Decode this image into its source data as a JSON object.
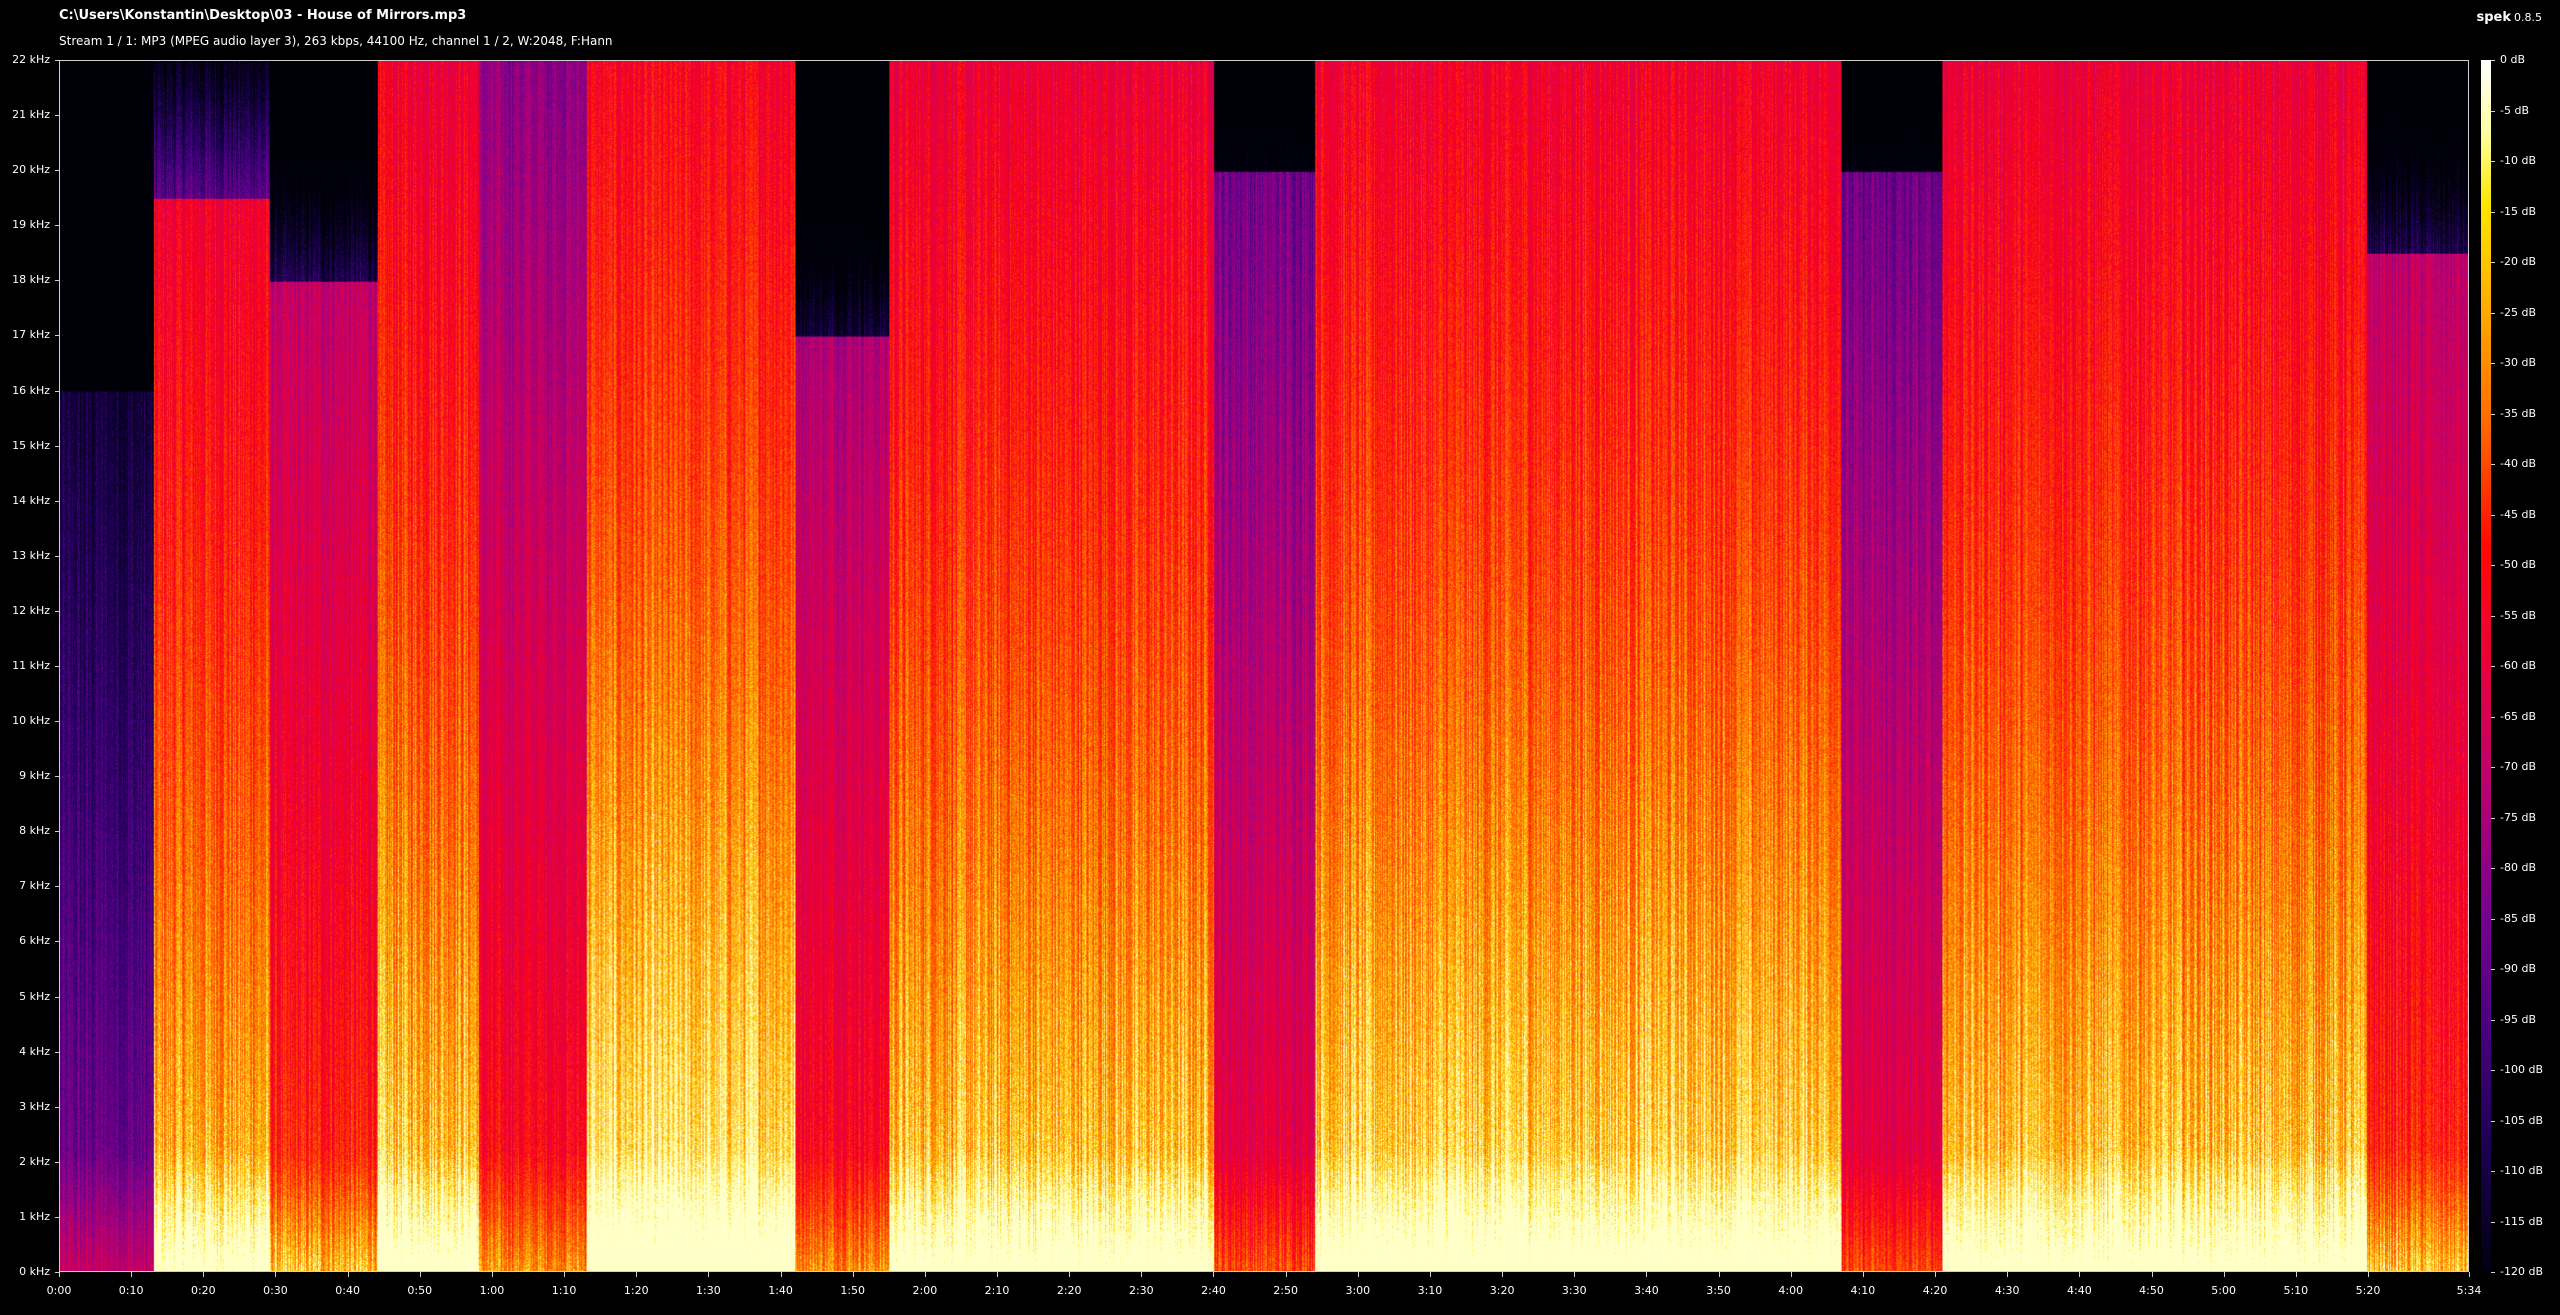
{
  "header": {
    "file_path": "C:\\Users\\Konstantin\\Desktop\\03 - House of Mirrors.mp3",
    "stream_info": "Stream 1 / 1: MP3 (MPEG audio layer 3), 263 kbps, 44100 Hz, channel 1 / 2, W:2048, F:Hann",
    "app_name": "spek",
    "app_version": "0.8.5"
  },
  "frequency_axis": {
    "labels": [
      "22 kHz",
      "21 kHz",
      "20 kHz",
      "19 kHz",
      "18 kHz",
      "17 kHz",
      "16 kHz",
      "15 kHz",
      "14 kHz",
      "13 kHz",
      "12 kHz",
      "11 kHz",
      "10 kHz",
      "9 kHz",
      "8 kHz",
      "7 kHz",
      "6 kHz",
      "5 kHz",
      "4 kHz",
      "3 kHz",
      "2 kHz",
      "1 kHz",
      "0 kHz"
    ]
  },
  "time_axis": {
    "labels": [
      "0:00",
      "0:10",
      "0:20",
      "0:30",
      "0:40",
      "0:50",
      "1:00",
      "1:10",
      "1:20",
      "1:30",
      "1:40",
      "1:50",
      "2:00",
      "2:10",
      "2:20",
      "2:30",
      "2:40",
      "2:50",
      "3:00",
      "3:10",
      "3:20",
      "3:30",
      "3:40",
      "3:50",
      "4:00",
      "4:10",
      "4:20",
      "4:30",
      "4:40",
      "4:50",
      "5:00",
      "5:10",
      "5:20",
      "5:34"
    ],
    "label_seconds": [
      0,
      10,
      20,
      30,
      40,
      50,
      60,
      70,
      80,
      90,
      100,
      110,
      120,
      130,
      140,
      150,
      160,
      170,
      180,
      190,
      200,
      210,
      220,
      230,
      240,
      250,
      260,
      270,
      280,
      290,
      300,
      310,
      320,
      334
    ],
    "duration_seconds": 334
  },
  "color_scale": {
    "labels": [
      "0 dB",
      "-5 dB",
      "-10 dB",
      "-15 dB",
      "-20 dB",
      "-25 dB",
      "-30 dB",
      "-35 dB",
      "-40 dB",
      "-45 dB",
      "-50 dB",
      "-55 dB",
      "-60 dB",
      "-65 dB",
      "-70 dB",
      "-75 dB",
      "-80 dB",
      "-85 dB",
      "-90 dB",
      "-95 dB",
      "-100 dB",
      "-105 dB",
      "-110 dB",
      "-115 dB",
      "-120 dB"
    ]
  },
  "spectrogram": {
    "segments": [
      {
        "start": 0,
        "end": 13,
        "level": 0.12,
        "cutoff_khz": 16
      },
      {
        "start": 13,
        "end": 29,
        "level": 0.72,
        "cutoff_khz": 19.5
      },
      {
        "start": 29,
        "end": 44,
        "level": 0.55,
        "cutoff_khz": 18
      },
      {
        "start": 44,
        "end": 58,
        "level": 0.75,
        "cutoff_khz": 22
      },
      {
        "start": 58,
        "end": 73,
        "level": 0.5,
        "cutoff_khz": 22
      },
      {
        "start": 73,
        "end": 102,
        "level": 0.78,
        "cutoff_khz": 22
      },
      {
        "start": 102,
        "end": 115,
        "level": 0.5,
        "cutoff_khz": 17
      },
      {
        "start": 115,
        "end": 160,
        "level": 0.74,
        "cutoff_khz": 22
      },
      {
        "start": 160,
        "end": 174,
        "level": 0.42,
        "cutoff_khz": 20
      },
      {
        "start": 174,
        "end": 247,
        "level": 0.76,
        "cutoff_khz": 22
      },
      {
        "start": 247,
        "end": 261,
        "level": 0.4,
        "cutoff_khz": 20
      },
      {
        "start": 261,
        "end": 320,
        "level": 0.74,
        "cutoff_khz": 22
      },
      {
        "start": 320,
        "end": 334,
        "level": 0.55,
        "cutoff_khz": 18.5
      }
    ]
  }
}
